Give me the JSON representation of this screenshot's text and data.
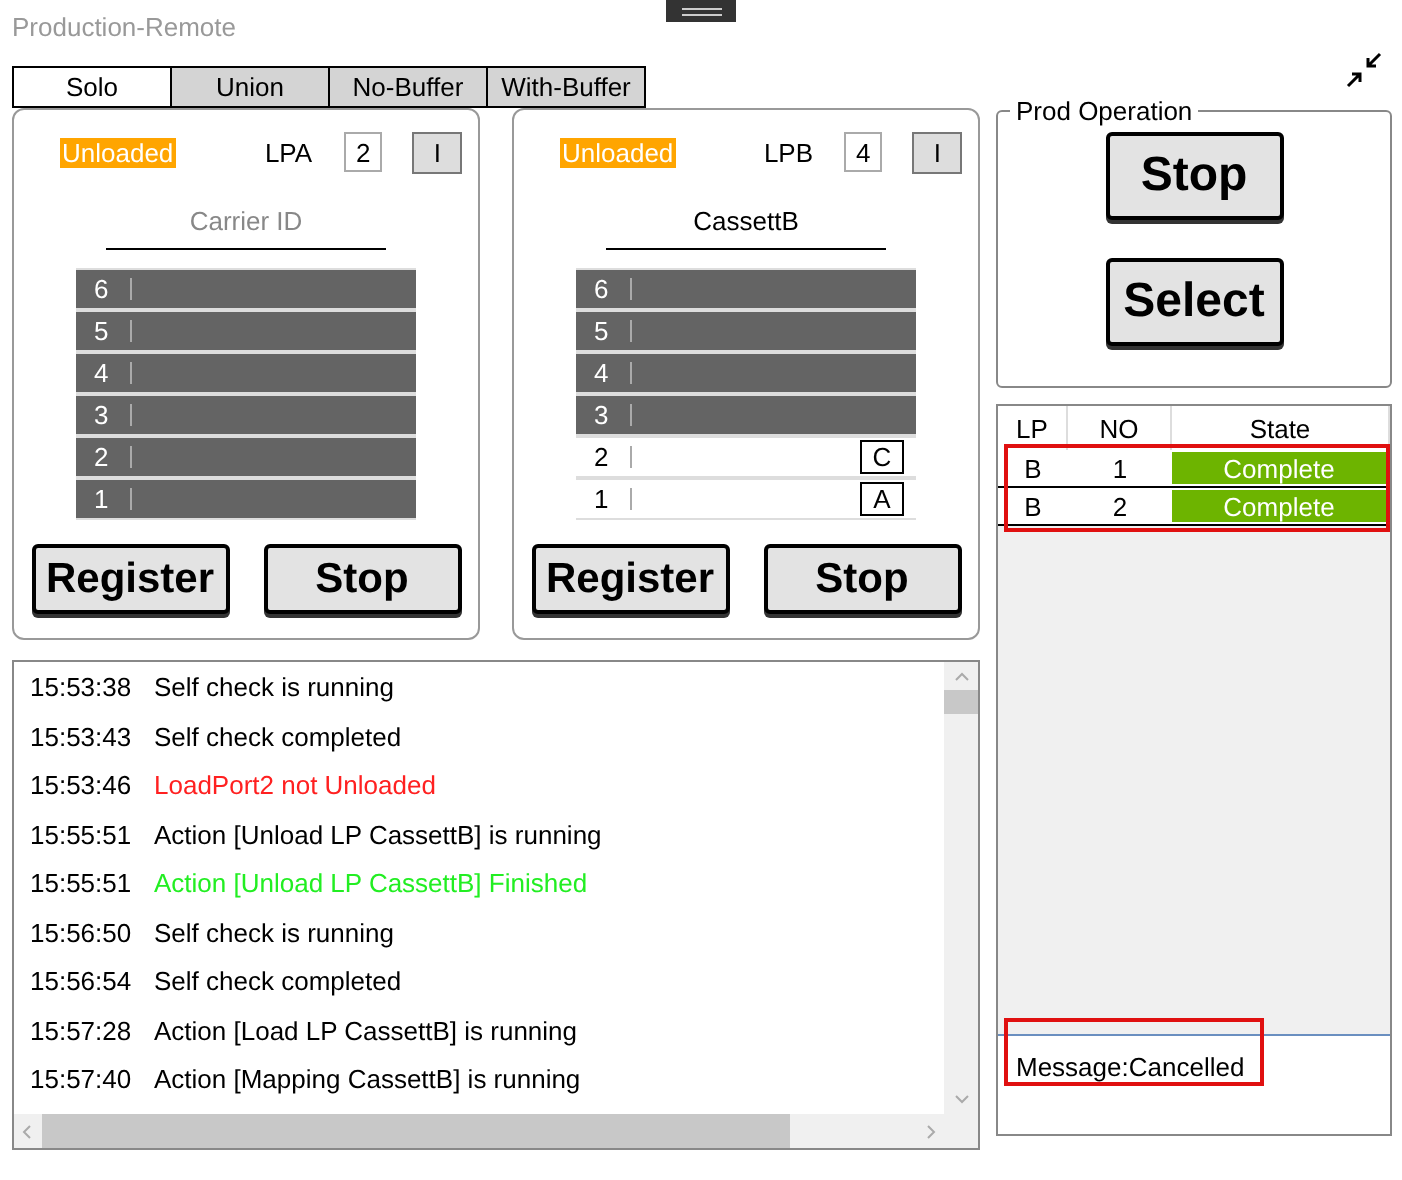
{
  "window": {
    "title": "Production-Remote"
  },
  "tabs": [
    {
      "label": "Solo",
      "selected": true
    },
    {
      "label": "Union",
      "selected": false
    },
    {
      "label": "No-Buffer",
      "selected": false
    },
    {
      "label": "With-Buffer",
      "selected": false
    }
  ],
  "load_ports": [
    {
      "status": "Unloaded",
      "name": "LPA",
      "count": "2",
      "mode_button": "I",
      "carrier": {
        "placeholder": "Carrier ID"
      },
      "slots": [
        {
          "number": "6",
          "kind": "empty"
        },
        {
          "number": "5",
          "kind": "empty"
        },
        {
          "number": "4",
          "kind": "empty"
        },
        {
          "number": "3",
          "kind": "empty"
        },
        {
          "number": "2",
          "kind": "empty"
        },
        {
          "number": "1",
          "kind": "empty"
        }
      ],
      "buttons": [
        "Register",
        "Stop"
      ]
    },
    {
      "status": "Unloaded",
      "name": "LPB",
      "count": "4",
      "mode_button": "I",
      "carrier": {
        "value": "CassettB"
      },
      "slots": [
        {
          "number": "6",
          "kind": "empty"
        },
        {
          "number": "5",
          "kind": "empty"
        },
        {
          "number": "4",
          "kind": "empty"
        },
        {
          "number": "3",
          "kind": "empty"
        },
        {
          "number": "2",
          "kind": "wafer",
          "tag": "C"
        },
        {
          "number": "1",
          "kind": "wafer",
          "tag": "A"
        }
      ],
      "buttons": [
        "Register",
        "Stop"
      ]
    }
  ],
  "log": [
    {
      "time": "15:53:38",
      "text": "Self check is running",
      "kind": "info"
    },
    {
      "time": "15:53:43",
      "text": "Self check completed",
      "kind": "info"
    },
    {
      "time": "15:53:46",
      "text": "LoadPort2 not Unloaded",
      "kind": "error"
    },
    {
      "time": "15:55:51",
      "text": "Action [Unload LP CassettB] is running",
      "kind": "info"
    },
    {
      "time": "15:55:51",
      "text": "Action [Unload LP CassettB] Finished",
      "kind": "success"
    },
    {
      "time": "15:56:50",
      "text": "Self check is running",
      "kind": "info"
    },
    {
      "time": "15:56:54",
      "text": "Self check completed",
      "kind": "info"
    },
    {
      "time": "15:57:28",
      "text": "Action [Load LP CassettB] is running",
      "kind": "info"
    },
    {
      "time": "15:57:40",
      "text": "Action [Mapping CassettB] is running",
      "kind": "info"
    }
  ],
  "prod_operation": {
    "title": "Prod Operation",
    "buttons": [
      "Stop",
      "Select"
    ]
  },
  "table": {
    "columns": [
      "LP",
      "NO",
      "State"
    ],
    "highlighted": true,
    "rows": [
      {
        "lp": "B",
        "no": "1",
        "state": "Complete"
      },
      {
        "lp": "B",
        "no": "2",
        "state": "Complete"
      }
    ]
  },
  "message": {
    "text": "Message:Cancelled",
    "highlighted": true
  }
}
